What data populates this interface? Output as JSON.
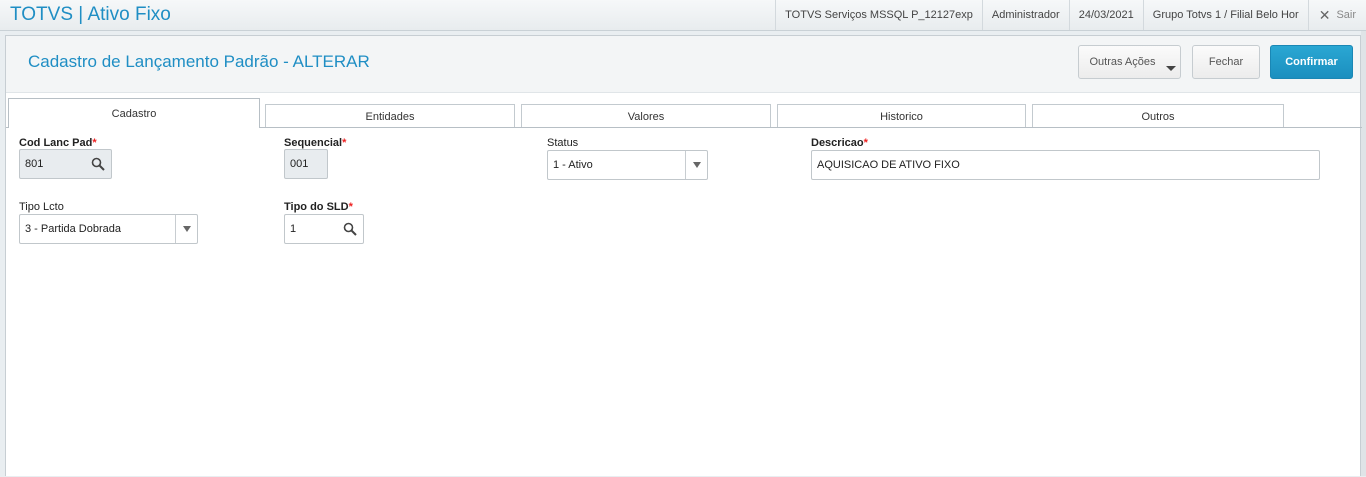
{
  "app": {
    "title": "TOTVS | Ativo Fixo",
    "environment": "TOTVS Serviços MSSQL P_12127exp",
    "user": "Administrador",
    "date": "24/03/2021",
    "branch": "Grupo Totvs 1 / Filial Belo Hor",
    "exit_label": "Sair"
  },
  "page": {
    "title": "Cadastro de Lançamento Padrão - ALTERAR",
    "actions": {
      "other": "Outras Ações",
      "close": "Fechar",
      "confirm": "Confirmar"
    }
  },
  "tabs": [
    {
      "label": "Cadastro",
      "active": true
    },
    {
      "label": "Entidades",
      "active": false
    },
    {
      "label": "Valores",
      "active": false
    },
    {
      "label": "Historico",
      "active": false
    },
    {
      "label": "Outros",
      "active": false
    }
  ],
  "form": {
    "cod_lanc_pad": {
      "label": "Cod Lanc Pad",
      "required_mark": "*",
      "value": "801"
    },
    "sequencial": {
      "label": "Sequencial",
      "required_mark": "*",
      "value": "001"
    },
    "status": {
      "label": "Status",
      "value": "1 - Ativo"
    },
    "descricao": {
      "label": "Descricao",
      "required_mark": "*",
      "value": "AQUISICAO DE ATIVO FIXO"
    },
    "tipo_lcto": {
      "label": "Tipo Lcto",
      "value": "3 - Partida Dobrada"
    },
    "tipo_sld": {
      "label": "Tipo do SLD",
      "required_mark": "*",
      "value": "1"
    }
  },
  "colors": {
    "accent": "#1f8ec4",
    "confirm_button": "#1b8fbf",
    "required": "#ee2222"
  }
}
